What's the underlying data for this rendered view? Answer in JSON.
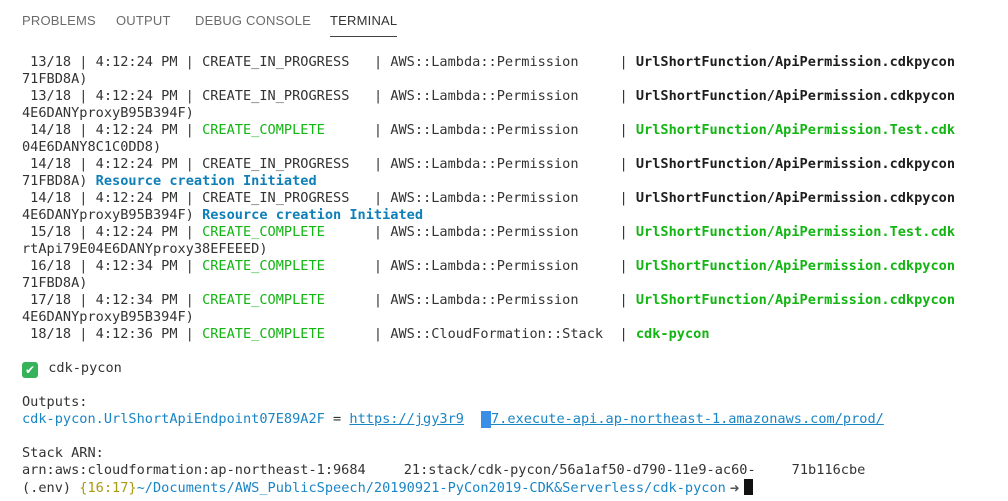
{
  "tabs": [
    {
      "label": "PROBLEMS",
      "active": false
    },
    {
      "label": "OUTPUT",
      "active": false
    },
    {
      "label": "DEBUG CONSOLE",
      "active": false
    },
    {
      "label": "TERMINAL",
      "active": true
    }
  ],
  "colors": {
    "complete": "#12b512",
    "info": "#1a85c6",
    "text": "#333333"
  },
  "terminal": {
    "rows": [
      {
        "prefix": " 13/18 | 4:12:24 PM | ",
        "status": "CREATE_IN_PROGRESS",
        "status_type": "progress",
        "pad": "   | ",
        "type": "AWS::Lambda::Permission",
        "pad2": "     | ",
        "resource": "UrlShortFunction/ApiPermission.cdkpycon",
        "cont": "71FBD8A)",
        "note": ""
      },
      {
        "prefix": " 13/18 | 4:12:24 PM | ",
        "status": "CREATE_IN_PROGRESS",
        "status_type": "progress",
        "pad": "   | ",
        "type": "AWS::Lambda::Permission",
        "pad2": "     | ",
        "resource": "UrlShortFunction/ApiPermission.cdkpycon",
        "cont": "4E6DANYproxyB95B394F)",
        "note": ""
      },
      {
        "prefix": " 14/18 | 4:12:24 PM | ",
        "status": "CREATE_COMPLETE",
        "status_type": "complete",
        "pad": "      | ",
        "type": "AWS::Lambda::Permission",
        "pad2": "     | ",
        "resource": "UrlShortFunction/ApiPermission.Test.cdk",
        "cont": "04E6DANY8C1C0DD8)",
        "note": ""
      },
      {
        "prefix": " 14/18 | 4:12:24 PM | ",
        "status": "CREATE_IN_PROGRESS",
        "status_type": "progress",
        "pad": "   | ",
        "type": "AWS::Lambda::Permission",
        "pad2": "     | ",
        "resource": "UrlShortFunction/ApiPermission.cdkpycon",
        "cont": "71FBD8A) ",
        "note": "Resource creation Initiated"
      },
      {
        "prefix": " 14/18 | 4:12:24 PM | ",
        "status": "CREATE_IN_PROGRESS",
        "status_type": "progress",
        "pad": "   | ",
        "type": "AWS::Lambda::Permission",
        "pad2": "     | ",
        "resource": "UrlShortFunction/ApiPermission.cdkpycon",
        "cont": "4E6DANYproxyB95B394F) ",
        "note": "Resource creation Initiated"
      },
      {
        "prefix": " 15/18 | 4:12:24 PM | ",
        "status": "CREATE_COMPLETE",
        "status_type": "complete",
        "pad": "      | ",
        "type": "AWS::Lambda::Permission",
        "pad2": "     | ",
        "resource": "UrlShortFunction/ApiPermission.Test.cdk",
        "cont": "rtApi79E04E6DANYproxy38EFEEED)",
        "note": ""
      },
      {
        "prefix": " 16/18 | 4:12:34 PM | ",
        "status": "CREATE_COMPLETE",
        "status_type": "complete",
        "pad": "      | ",
        "type": "AWS::Lambda::Permission",
        "pad2": "     | ",
        "resource": "UrlShortFunction/ApiPermission.cdkpycon",
        "cont": "71FBD8A)",
        "note": ""
      },
      {
        "prefix": " 17/18 | 4:12:34 PM | ",
        "status": "CREATE_COMPLETE",
        "status_type": "complete",
        "pad": "      | ",
        "type": "AWS::Lambda::Permission",
        "pad2": "     | ",
        "resource": "UrlShortFunction/ApiPermission.cdkpycon",
        "cont": "4E6DANYproxyB95B394F)",
        "note": ""
      },
      {
        "prefix": " 18/18 | 4:12:36 PM | ",
        "status": "CREATE_COMPLETE",
        "status_type": "complete",
        "pad": "      | ",
        "type": "AWS::CloudFormation::Stack",
        "pad2": "  | ",
        "resource": "cdk-pycon",
        "cont": "",
        "note": ""
      }
    ],
    "success_label": "cdk-pycon",
    "outputs_label": "Outputs:",
    "output_key_a": "cdk-pycon.",
    "output_key_b": "UrlShortApiEndpoint07E89A2F",
    "output_eq": " = ",
    "output_url_a": "https://jgy3r9",
    "output_url_b": "7.execute-api.ap-northeast-1.amazonaws.com/prod/",
    "stack_arn_label": "Stack ARN:",
    "arn_a": "arn:aws:cloudformation:ap-northeast-1:9684",
    "arn_b": "21:stack/cdk-pycon/56a1af50-d790-11e9-ac60-",
    "arn_c": "71b116cbe",
    "prompt_env": "(.env) ",
    "prompt_time": "{16:17}",
    "prompt_path": "~/Documents/AWS_PublicSpeech/20190921-PyCon2019-CDK&Serverless/cdk-pycon",
    "prompt_symbol": " ➜ "
  }
}
